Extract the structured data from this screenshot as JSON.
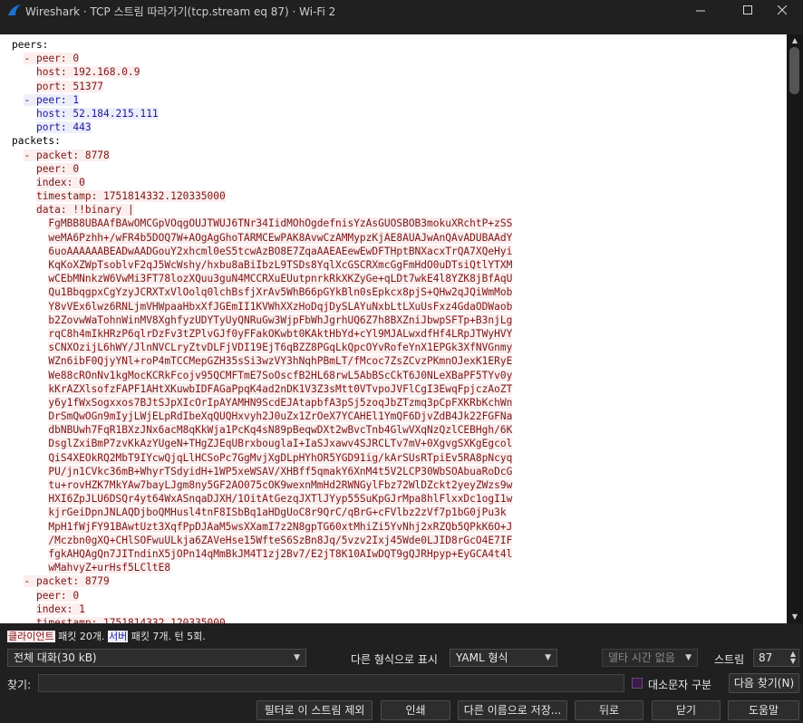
{
  "window": {
    "title": "Wireshark · TCP 스트림 따라가기(tcp.stream eq 87) · Wi-Fi 2"
  },
  "stream_lines": [
    {
      "t": "peers:",
      "k": "p"
    },
    {
      "t": "  - peer: 0",
      "k": "c"
    },
    {
      "t": "    host: 192.168.0.9",
      "k": "c"
    },
    {
      "t": "    port: 51377",
      "k": "c"
    },
    {
      "t": "  - peer: 1",
      "k": "s"
    },
    {
      "t": "    host: 52.184.215.111",
      "k": "s"
    },
    {
      "t": "    port: 443",
      "k": "s"
    },
    {
      "t": "packets:",
      "k": "p"
    },
    {
      "t": "  - packet: 8778",
      "k": "c"
    },
    {
      "t": "    peer: 0",
      "k": "c"
    },
    {
      "t": "    index: 0",
      "k": "c"
    },
    {
      "t": "    timestamp: 1751814332.120335000",
      "k": "c"
    },
    {
      "t": "    data: !!binary |",
      "k": "c"
    },
    {
      "t": "      FgMBB8UBAAfBAwOMCGpVOqgOUJTWUJ6TNr34IidMOhOgdefnisYzAsGUOSBOB3mokuXRchtP+zSS",
      "k": "c"
    },
    {
      "t": "      weMA6Pzhh+/wFR4b5DOQ7W+AOgAgGhoTARMCEwPAK8AvwCzAMMypzKjAE8AUAJwAnQAvADUBAAdY",
      "k": "c"
    },
    {
      "t": "      6uoAAAAAABEADwAADGouY2xhcml0eS5tcwAzBO8E7ZqaAAEAEewEwDFTHptBNXacxTrQA7XQeHyi",
      "k": "c"
    },
    {
      "t": "      KqKoXZWpTsoblvF2qJ5WcWshy/hxbu8aBiIbzL9TSDs8YqlXcGSCRXmcGgFmHdO0uDTsiQtlYTXM",
      "k": "c"
    },
    {
      "t": "      wCEbMNnkzW6VwMi3FT78lozXQuu3guN4MCCRXuEUutpnrkRkXKZyGe+qLDt7wkE4l8YZK8jBfAqU",
      "k": "c"
    },
    {
      "t": "      Qu1BbqgpxCgYzyJCRXTxVlOolq0lchBsfjXrAv5WhB66pGYkBln0sEpkcx8pjS+QHw2qJQiWmMob",
      "k": "c"
    },
    {
      "t": "      Y8vVEx6lwz6RNLjmVHWpaaHbxXfJGEmII1KVWhXXzHoDqjDySLAYuNxbLtLXuUsFxz4GdaODWaob",
      "k": "c"
    },
    {
      "t": "      b2ZovwWaTohnWinMV8XghfyzUDYTyUyQNRuGw3WjpFbWhJgrhUQ6Z7h8BXZniJbwpSFTp+B3njLg",
      "k": "c"
    },
    {
      "t": "      rqC8h4mIkHRzP6qlrDzFv3tZPlvGJf0yFFakOKwbt0KAktHbYd+cYl9MJALwxdfHf4LRpJTWyHVY",
      "k": "c"
    },
    {
      "t": "      sCNXOzijL6hWY/JlnNVCLryZtvDLFjVDI19EjT6qBZZ8PGqLkQpcOYvRofeYnX1EPGk3XfNVGnmy",
      "k": "c"
    },
    {
      "t": "      WZn6ibF0QjyYNl+roP4mTCCMepGZH35sSi3wzVY3hNqhPBmLT/fMcoc7ZsZCvzPKmnOJexK1ERyE",
      "k": "c"
    },
    {
      "t": "      We88cROnNv1kgMocKCRkFcojv95QCMFTmE7SoOscfB2HL68rwL5AbBScCkT6J0NLeXBaPF5TYv0y",
      "k": "c"
    },
    {
      "t": "      kKrAZXlsofzFAPF1AHtXKuwbIDFAGaPpqK4ad2nDK1V3Z3sMtt0VTvpoJVFlCgI3EwqFpjczAoZT",
      "k": "c"
    },
    {
      "t": "      y6y1fWxSogxxos7BJtSJpXIcOrIpAYAMHN9ScdEJAtapbfA3pSj5zoqJbZTzmq3pCpFXKRbKchWn",
      "k": "c"
    },
    {
      "t": "      DrSmQwOGn9mIyjLWjELpRdIbeXqQUQHxvyh2J0uZx1ZrOeX7YCAHEl1YmQF6DjvZdB4Jk22FGFNa",
      "k": "c"
    },
    {
      "t": "      dbNBUwh7FqR1BXzJNx6acM8qKkWja1PcKq4sN89pBeqwDXt2wBvcTnb4GlwVXqNzQzlCEBHgh/6K",
      "k": "c"
    },
    {
      "t": "      DsglZxiBmP7zvKkAzYUgeN+THgZJEqUBrxbouglaI+IaSJxawv4SJRCLTv7mV+0XgvgSXKgEgcol",
      "k": "c"
    },
    {
      "t": "      QiS4XEOkRQ2MbT9IYcwQjqLlHCSoPc7GgMvjXgDLpHYhOR5YGD91ig/kArSUsRTpiEv5RA8pNcyq",
      "k": "c"
    },
    {
      "t": "      PU/jn1CVkc36mB+WhyrTSdyidH+1WP5xeWSAV/XHBff5qmakY6XnM4t5V2LCP30WbSOAbuaRoDcG",
      "k": "c"
    },
    {
      "t": "      tu+rovHZK7MkYAw7bayLJgm8ny5GF2AO075cOK9wexnMmHd2RWNGylFbz72WlDZckt2yeyZWzs9w",
      "k": "c"
    },
    {
      "t": "      HXI6ZpJLU6DSQr4yt64WxASnqaDJXH/1OitAtGezqJXTlJYyp55SuKpGJrMpa8hlFlxxDc1ogI1w",
      "k": "c"
    },
    {
      "t": "      kjrGeiDpnJNLAQDjboQMHusl4tnF8ISbBq1aHDgUoC8r9QrC/qBrG+cFVlbz2zVf7p1bG0jPu3k",
      "k": "c"
    },
    {
      "t": "      MpH1fWjFY91BAwtUzt3XqfPpDJAaM5wsXXamI7z2N8gpTG60xtMhiZi5YvNhj2xRZQb5QPkK6O+J",
      "k": "c"
    },
    {
      "t": "      /Mczbn0gXQ+CHlSOFwuULkja6ZAVeHse15WfteS6SzBn8Jq/5vzv2Ixj45Wde0LJID8rGcO4E7IF",
      "k": "c"
    },
    {
      "t": "      fgkAHQAgQn7JITndinX5jOPn14qMmBkJM4T1zj2Bv7/E2jT8K10AIwDQT9gQJRHpyp+EyGCA4t4l",
      "k": "c"
    },
    {
      "t": "      wMahvyZ+urHsf5LCltE8",
      "k": "c"
    },
    {
      "t": "  - packet: 8779",
      "k": "c"
    },
    {
      "t": "    peer: 0",
      "k": "c"
    },
    {
      "t": "    index: 1",
      "k": "c"
    },
    {
      "t": "    timestamp: 1751814332.120335000",
      "k": "c"
    }
  ],
  "summary": {
    "client_label": "클라이언트",
    "client_text": " 패킷 20개. ",
    "server_label": "서버",
    "server_text": " 패킷 7개. 턴 5회."
  },
  "controls": {
    "conversation_select": "전체 대화(30 kB)",
    "show_as_label": "다른 형식으로 표시",
    "format_select": "YAML 형식",
    "delta_select": "델타 시간 없음",
    "stream_label": "스트림",
    "stream_value": "87",
    "find_label": "찾기:",
    "find_value": "",
    "case_sensitive_label": "대소문자 구분",
    "find_next_button": "다음 찾기(N)"
  },
  "buttons": {
    "filter_out": "필터로 이 스트림 제외",
    "print": "인쇄",
    "save_as": "다른 이름으로 저장...",
    "back": "뒤로",
    "close": "닫기",
    "help": "도움말"
  },
  "colors": {
    "client_bg": "#fbeeee",
    "client_fg": "#7b1717",
    "server_bg": "#eeeefb",
    "server_fg": "#19199b"
  }
}
